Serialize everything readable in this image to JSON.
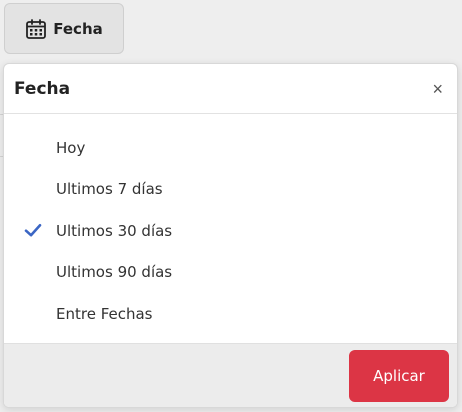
{
  "trigger": {
    "label": "Fecha",
    "icon": "calendar-icon"
  },
  "popover": {
    "title": "Fecha",
    "close_label": "×",
    "options": [
      {
        "label": "Hoy",
        "selected": false
      },
      {
        "label": "Ultimos 7 días",
        "selected": false
      },
      {
        "label": "Ultimos 30 días",
        "selected": true
      },
      {
        "label": "Ultimos 90 días",
        "selected": false
      },
      {
        "label": "Entre Fechas",
        "selected": false
      }
    ],
    "apply_label": "Aplicar"
  },
  "colors": {
    "accent": "#3b66c4",
    "apply_button": "#dc3545",
    "footer_bg": "#ececec",
    "page_bg": "#eeeeee"
  }
}
